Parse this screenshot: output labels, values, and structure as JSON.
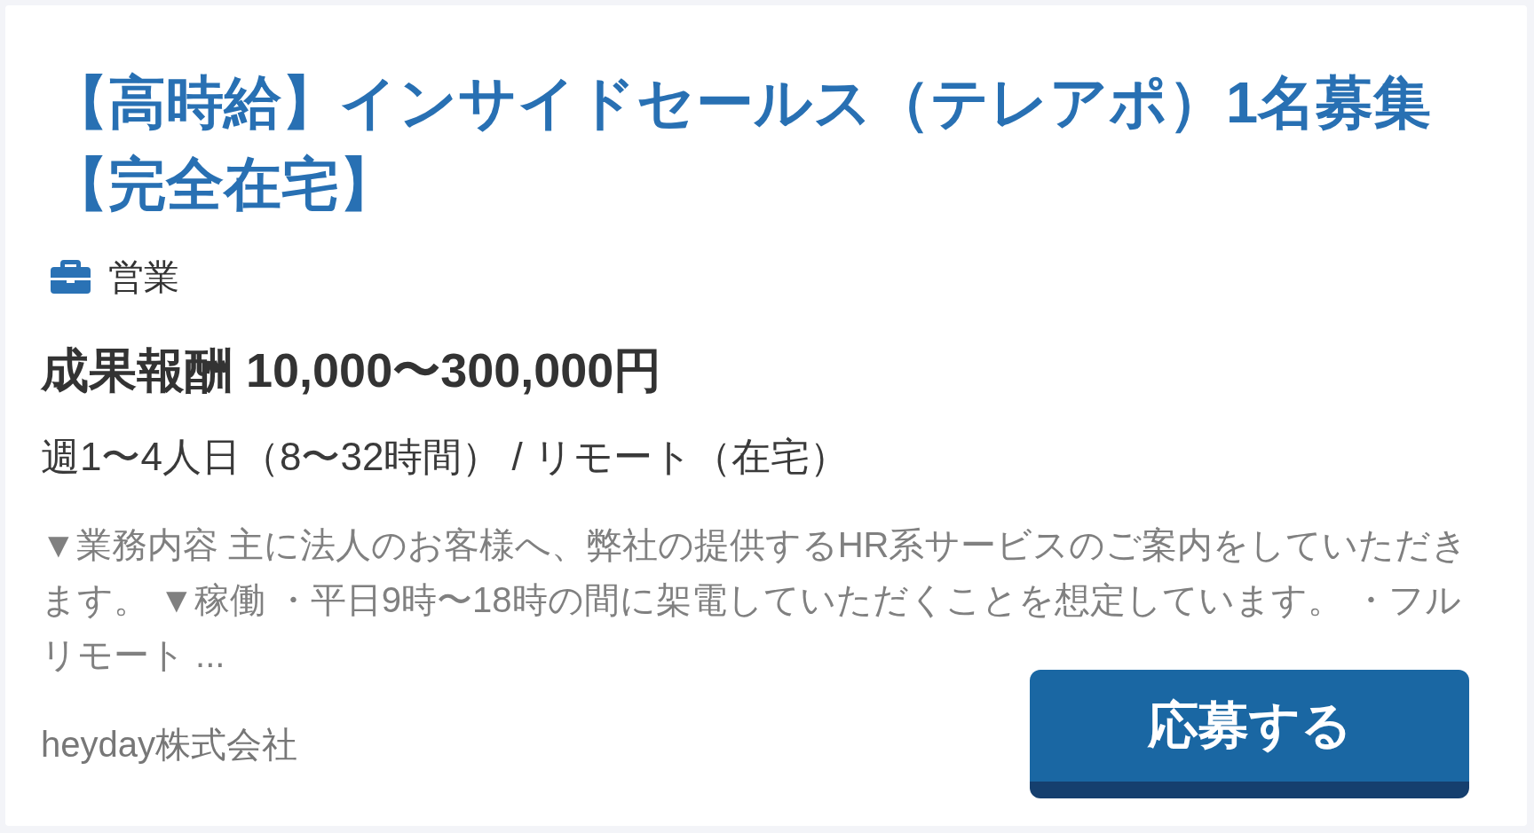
{
  "job_card": {
    "title": "【高時給】インサイドセールス（テレアポ）1名募集【完全在宅】",
    "category": "営業",
    "salary": "成果報酬 10,000〜300,000円",
    "schedule": "週1〜4人日（8〜32時間） / リモート（在宅）",
    "description": "▼業務内容 主に法人のお客様へ、弊社の提供するHR系サービスのご案内をしていただきます。 ▼稼働 ・平日9時〜18時の間に架電していただくことを想定しています。 ・フルリモート ...",
    "company": "heyday株式会社",
    "apply_button": "応募する"
  }
}
